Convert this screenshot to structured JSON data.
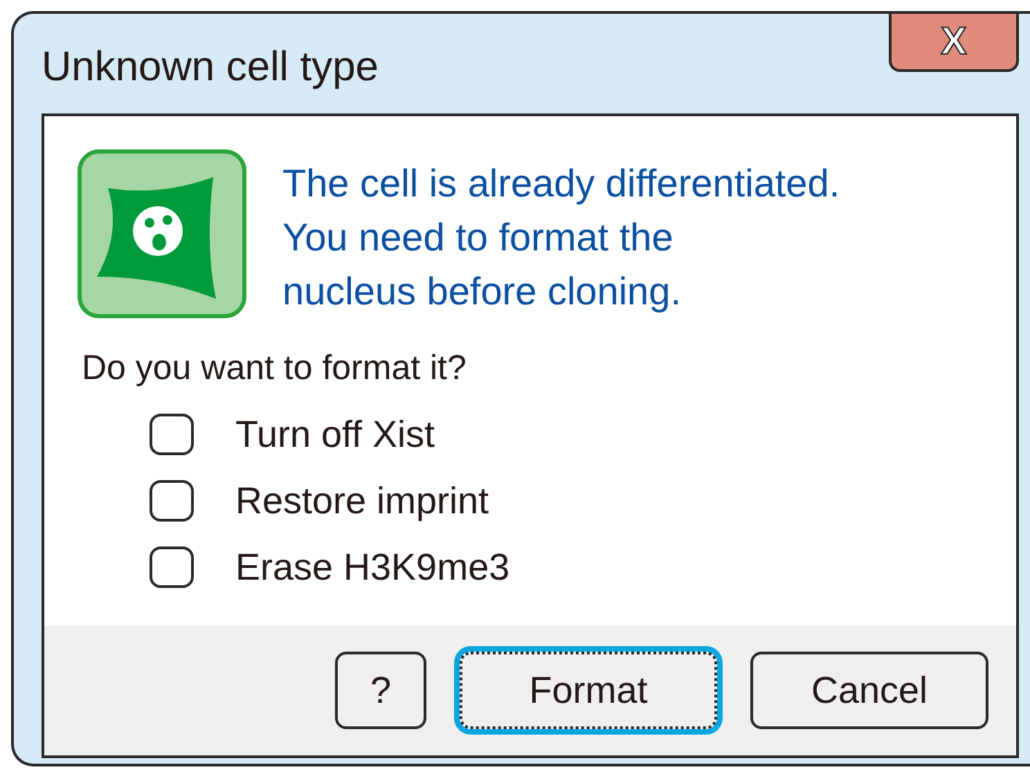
{
  "window": {
    "title": "Unknown cell type",
    "close_label": "X"
  },
  "message": {
    "lines": [
      "The cell is already differentiated.",
      "You need to format the",
      "nucleus before cloning."
    ]
  },
  "question": "Do you want to format it?",
  "options": [
    {
      "label": "Turn off Xist",
      "checked": false
    },
    {
      "label": "Restore imprint",
      "checked": false
    },
    {
      "label": "Erase H3K9me3",
      "checked": false
    }
  ],
  "buttons": [
    {
      "label": "?",
      "focused": false
    },
    {
      "label": "Format",
      "focused": true
    },
    {
      "label": "Cancel",
      "focused": false
    }
  ]
}
